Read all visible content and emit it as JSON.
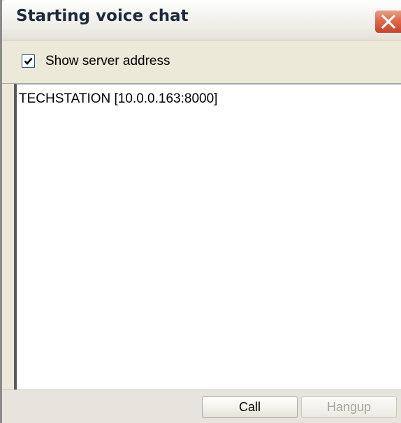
{
  "window": {
    "title": "Starting voice chat"
  },
  "options": {
    "show_server_address_label": "Show server address",
    "show_server_address_checked": true
  },
  "server_list": {
    "entries": [
      "TECHSTATION [10.0.0.163:8000]"
    ]
  },
  "buttons": {
    "call_label": "Call",
    "hangup_label": "Hangup",
    "hangup_enabled": false
  },
  "icons": {
    "close": "close-icon",
    "checkmark": "checkmark-icon"
  },
  "colors": {
    "close_button": "#e06848",
    "disabled_text": "#a7a69c",
    "dialog_background": "#ece9d8"
  }
}
